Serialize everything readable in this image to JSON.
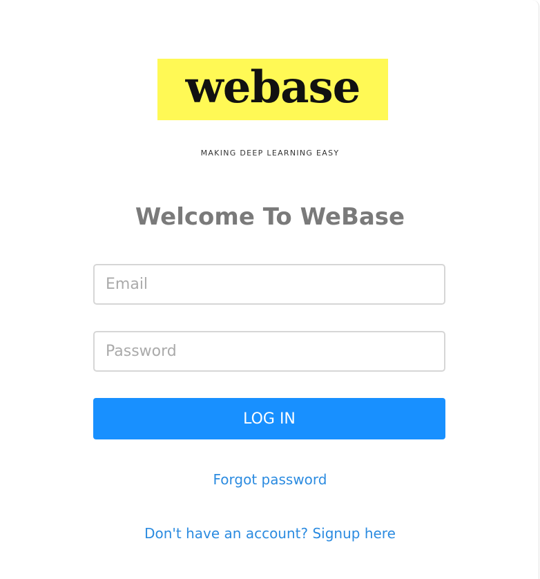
{
  "brand": {
    "logo_text": "webase",
    "tagline": "MAKING DEEP LEARNING EASY",
    "logo_bg_color": "#fff955"
  },
  "login": {
    "title": "Welcome To WeBase",
    "email_placeholder": "Email",
    "email_value": "",
    "password_placeholder": "Password",
    "password_value": "",
    "submit_label": "LOG IN",
    "forgot_label": "Forgot password",
    "signup_label": "Don't have an account? Signup here",
    "accent_color": "#1890ff"
  }
}
